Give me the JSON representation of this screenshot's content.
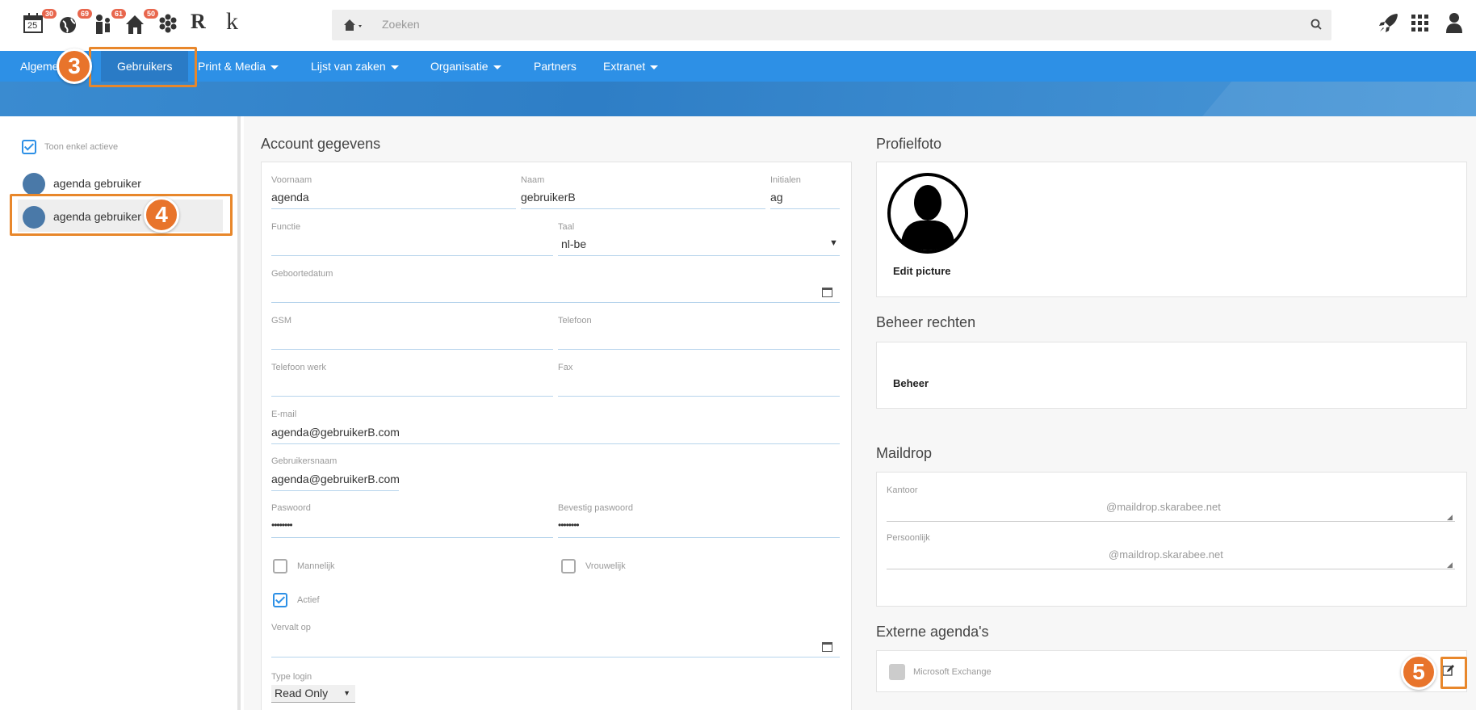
{
  "topbar": {
    "badges": [
      "30",
      "69",
      "61",
      "50"
    ],
    "calendar_day": "25",
    "logo_r": "R",
    "logo_k": "k",
    "search_placeholder": "Zoeken"
  },
  "nav": {
    "items": [
      {
        "label": "Algemeen",
        "dropdown": false
      },
      {
        "label": "Gebruikers",
        "dropdown": false,
        "active": true
      },
      {
        "label": "Print & Media",
        "dropdown": true
      },
      {
        "label": "Lijst van zaken",
        "dropdown": true
      },
      {
        "label": "Organisatie",
        "dropdown": true
      },
      {
        "label": "Partners",
        "dropdown": false
      },
      {
        "label": "Extranet",
        "dropdown": true
      }
    ]
  },
  "sidebar": {
    "filter_label": "Toon enkel actieve",
    "users": [
      {
        "label": "agenda gebruiker"
      },
      {
        "label": "agenda gebruiker",
        "selected": true
      }
    ]
  },
  "account": {
    "title": "Account gegevens",
    "voornaam_label": "Voornaam",
    "voornaam": "agenda",
    "naam_label": "Naam",
    "naam": "gebruikerB",
    "initialen_label": "Initialen",
    "initialen": "ag",
    "functie_label": "Functie",
    "functie": "",
    "taal_label": "Taal",
    "taal": "nl-be",
    "geboortedatum_label": "Geboortedatum",
    "gsm_label": "GSM",
    "telefoon_label": "Telefoon",
    "telefoon_werk_label": "Telefoon werk",
    "fax_label": "Fax",
    "email_label": "E-mail",
    "email": "agenda@gebruikerB.com",
    "gebruikersnaam_label": "Gebruikersnaam",
    "gebruikersnaam": "agenda@gebruikerB.com",
    "paswoord_label": "Paswoord",
    "paswoord": "••••••••",
    "bevestig_label": "Bevestig paswoord",
    "bevestig": "••••••••",
    "mannelijk_label": "Mannelijk",
    "vrouwelijk_label": "Vrouwelijk",
    "actief_label": "Actief",
    "vervalt_label": "Vervalt op",
    "type_login_label": "Type login",
    "type_login": "Read Only"
  },
  "profiel": {
    "title": "Profielfoto",
    "edit_label": "Edit picture"
  },
  "beheer": {
    "title": "Beheer rechten",
    "label": "Beheer"
  },
  "maildrop": {
    "title": "Maildrop",
    "kantoor_label": "Kantoor",
    "kantoor_domain": "@maildrop.skarabee.net",
    "persoonlijk_label": "Persoonlijk",
    "persoonlijk_domain": "@maildrop.skarabee.net"
  },
  "externe": {
    "title": "Externe agenda's",
    "exchange_label": "Microsoft Exchange"
  },
  "steps": [
    "3",
    "4",
    "5"
  ],
  "colors": {
    "nav_blue": "#2d90e6",
    "active_nav": "#2a7bc6",
    "step_orange": "#e8742b",
    "badge": "#e8664d"
  }
}
